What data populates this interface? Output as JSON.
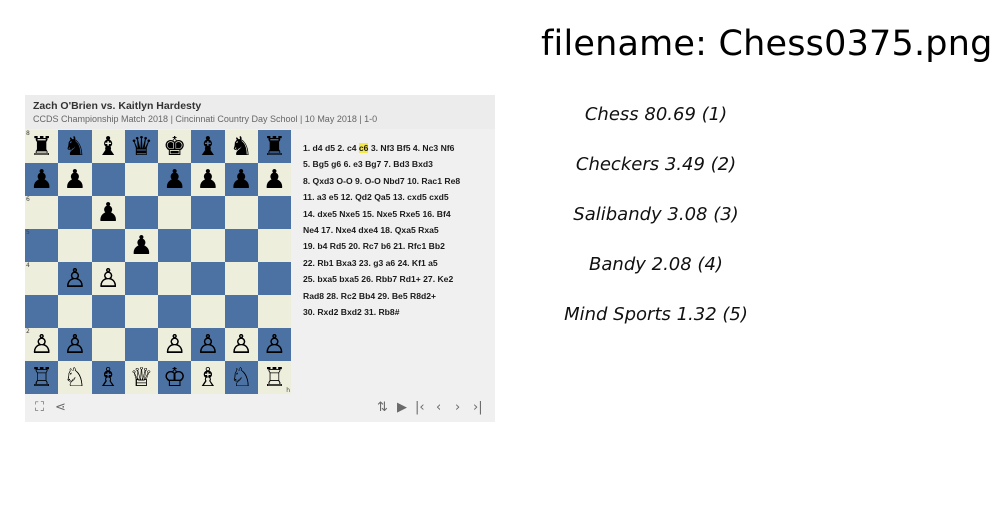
{
  "filename_label": "filename: Chess0375.png",
  "game": {
    "title": "Zach O'Brien vs. Kaitlyn Hardesty",
    "subtitle": "CCDS Championship Match 2018 | Cincinnati Country Day School | 10 May 2018 | 1-0"
  },
  "board": {
    "rows": [
      [
        "♜",
        "♞",
        "♝",
        "♛",
        "♚",
        "♝",
        "♞",
        "♜"
      ],
      [
        "♟",
        "♟",
        "",
        "",
        "♟",
        "♟",
        "♟",
        "♟"
      ],
      [
        "",
        "",
        "♟",
        "",
        "",
        "",
        "",
        ""
      ],
      [
        "",
        "",
        "",
        "♟",
        "",
        "",
        "",
        ""
      ],
      [
        "",
        "♙",
        "♙",
        "",
        "",
        "",
        "",
        ""
      ],
      [
        "",
        "",
        "",
        "",
        "",
        "",
        "",
        ""
      ],
      [
        "♙",
        "♙",
        "",
        "",
        "♙",
        "♙",
        "♙",
        "♙"
      ],
      [
        "♖",
        "♘",
        "♗",
        "♕",
        "♔",
        "♗",
        "♘",
        "♖"
      ]
    ],
    "rank_labels": [
      "8",
      "",
      "6",
      "5",
      "4",
      "",
      "2",
      ""
    ],
    "file_labels": [
      "",
      "",
      "",
      "",
      "",
      "",
      "",
      "h"
    ],
    "light_color": "#eeeedc",
    "dark_color": "#4b72a3"
  },
  "moves": {
    "line1_before": "1. d4 d5 2. c4 ",
    "line1_highlight": "c6",
    "line1_after": " 3. Nf3 Bf5 4. Nc3 Nf6",
    "lines": [
      "5. Bg5 g6 6. e3 Bg7 7. Bd3 Bxd3",
      "8. Qxd3 O-O 9. O-O Nbd7 10. Rac1 Re8",
      "11. a3 e5 12. Qd2 Qa5 13. cxd5 cxd5",
      "14. dxe5 Nxe5 15. Nxe5 Rxe5 16. Bf4",
      "Ne4 17. Nxe4 dxe4 18. Qxa5 Rxa5",
      "19. b4 Rd5 20. Rc7 b6 21. Rfc1 Bb2",
      "22. Rb1 Bxa3 23. g3 a6 24. Kf1 a5",
      "25. bxa5 bxa5 26. Rbb7 Rd1+ 27. Ke2",
      "Rad8 28. Rc2 Bb4 29. Be5 R8d2+",
      "30. Rxd2 Bxd2 31. Rb8#"
    ]
  },
  "toolbar": {
    "zoom_icon": "⛶",
    "share_icon": "⋖",
    "flip_icon": "⇅",
    "play_icon": "▶",
    "first_icon": "|‹",
    "prev_icon": "‹",
    "next_icon": "›",
    "last_icon": "›|"
  },
  "results": [
    "Chess 80.69 (1)",
    "Checkers  3.49 (2)",
    "Salibandy  3.08 (3)",
    "Bandy  2.08 (4)",
    "Mind Sports  1.32 (5)"
  ]
}
